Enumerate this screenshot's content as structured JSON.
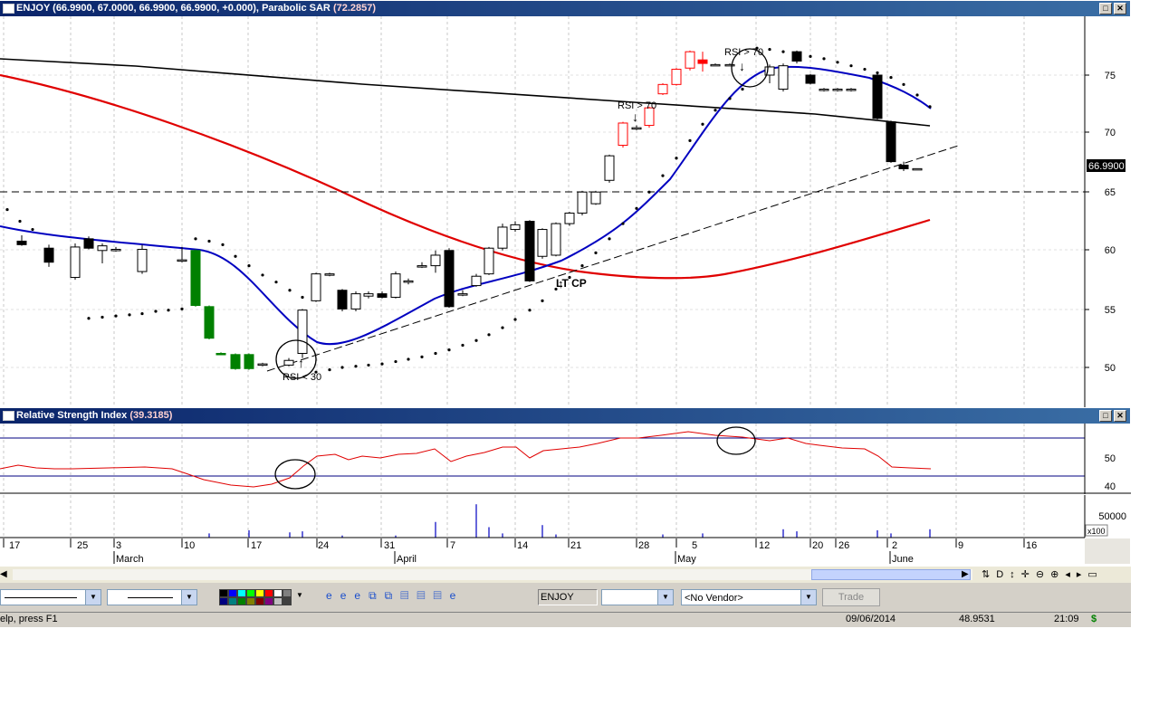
{
  "price_panel": {
    "symbol": "ENJOY",
    "ohlc_text": "(66.9900, 67.0000, 66.9900, 66.9900, +0.000),",
    "indicator_name": "Parabolic SAR",
    "indicator_value": "(72.2857)",
    "y_ticks": [
      "75",
      "70",
      "65",
      "60",
      "55",
      "50"
    ],
    "last_price_tag": "66.9900",
    "annotations": {
      "rsi_low": "RSI < 30",
      "rsi_high_1": "RSI > 70",
      "rsi_high_2": "RSI > 70",
      "lt_cp": "LT CP"
    }
  },
  "rsi_panel": {
    "name": "Relative Strength Index",
    "value": "(39.3185)",
    "y_ticks": [
      "50",
      "40"
    ]
  },
  "volume_panel": {
    "y_tick": "50000",
    "multiplier": "x100"
  },
  "date_axis": {
    "day_labels": [
      "17",
      "25",
      "3",
      "10",
      "17",
      "24",
      "31",
      "7",
      "14",
      "21",
      "28",
      "5",
      "12",
      "20",
      "26",
      "2",
      "9",
      "16"
    ],
    "month_labels": [
      "March",
      "April",
      "May",
      "June"
    ]
  },
  "toolbar": {
    "symbol_field": "ENJOY",
    "vendor_select": "<No Vendor>",
    "trade_button": "Trade",
    "nav_icons": [
      "refresh-icon",
      "daily-icon",
      "move-icon",
      "crosshair-icon",
      "zoom-out-icon",
      "zoom-in-icon",
      "prev-icon",
      "next-icon",
      "window-icon"
    ],
    "palette_colors": [
      "#000000",
      "#0000ff",
      "#00ffff",
      "#00ff00",
      "#ffff00",
      "#ff0000",
      "#ffffff",
      "#808080",
      "#000080",
      "#008080",
      "#008000",
      "#808000",
      "#800000",
      "#800080",
      "#c0c0c0",
      "#404040"
    ]
  },
  "status": {
    "help_text": "elp, press F1",
    "date": "09/06/2014",
    "value": "48.9531",
    "time": "21:09",
    "currency": "$"
  },
  "colors": {
    "up_candle": "#ff0000",
    "green_candle": "#008000",
    "sma_blue": "#0000c0",
    "sma_red": "#e00000",
    "rsi_line": "#e00000",
    "rsi_bands": "#000080"
  }
}
